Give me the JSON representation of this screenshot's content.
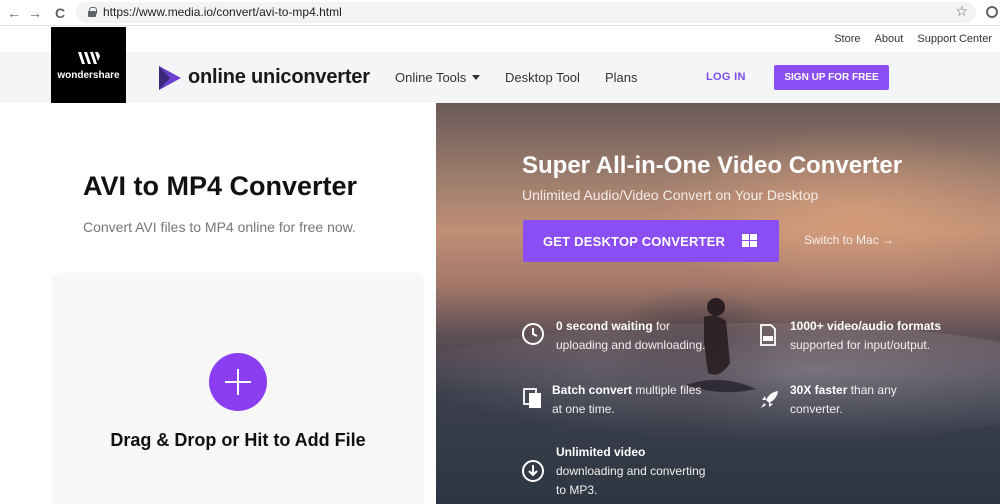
{
  "browser": {
    "back_glyph": "←",
    "forward_glyph": "→",
    "reload_glyph": "C",
    "url": "https://www.media.io/convert/avi-to-mp4.html",
    "star_glyph": "☆"
  },
  "top_links": {
    "store": "Store",
    "about": "About",
    "support": "Support Center"
  },
  "header": {
    "wondershare_label": "wondershare",
    "brand": "online uniconverter",
    "online_tools": "Online Tools",
    "desktop_tool": "Desktop Tool",
    "plans": "Plans",
    "login": "LOG IN",
    "signup": "SIGN UP FOR FREE"
  },
  "left": {
    "title": "AVI to MP4 Converter",
    "subtitle": "Convert AVI files to MP4 online for free now.",
    "drop_text": "Drag & Drop or Hit to Add File"
  },
  "hero": {
    "title": "Super All-in-One Video Converter",
    "subtitle": "Unlimited Audio/Video Convert on Your Desktop",
    "cta": "GET DESKTOP CONVERTER",
    "switch": "Switch to Mac →",
    "features": [
      {
        "bold": "0 second waiting",
        "rest1": " for",
        "line2": "uploading and downloading.",
        "icon": "clock-icon"
      },
      {
        "bold": "1000+ video/audio formats",
        "rest1": "",
        "line2": "supported for input/output.",
        "icon": "formats-icon"
      },
      {
        "bold": "Batch convert",
        "rest1": " multiple files",
        "line2": "at one time.",
        "icon": "copy-icon"
      },
      {
        "bold": "30X faster",
        "rest1": " than any",
        "line2": "converter.",
        "icon": "rocket-icon"
      },
      {
        "bold": "Unlimited video",
        "rest1": "",
        "line2": "downloading and converting",
        "line3": "to MP3.",
        "icon": "download-icon"
      }
    ]
  },
  "colors": {
    "accent": "#8b4ef4",
    "brand_dark": "#000000"
  }
}
